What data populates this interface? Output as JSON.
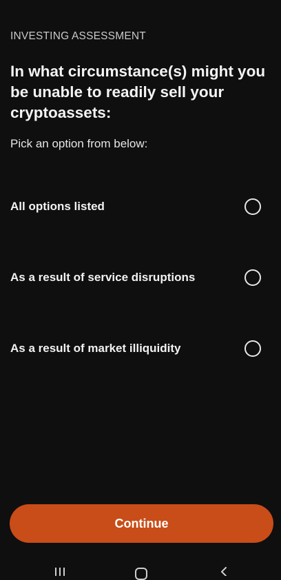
{
  "header": {
    "eyebrow": "INVESTING ASSESSMENT",
    "question": "In what circumstance(s) might you be unable to readily sell your cryptoassets:",
    "hint": "Pick an option from below:"
  },
  "options": [
    {
      "label": "All options listed",
      "selected": false
    },
    {
      "label": "As a result of service disruptions",
      "selected": false
    },
    {
      "label": "As a result of market illiquidity",
      "selected": false
    }
  ],
  "footer": {
    "continue_label": "Continue"
  },
  "colors": {
    "background": "#0f0f0f",
    "accent": "#c84d18",
    "radio_border": "#e8e8e8"
  },
  "system_nav": {
    "icons": [
      "recent-apps-icon",
      "home-icon",
      "back-icon"
    ]
  }
}
